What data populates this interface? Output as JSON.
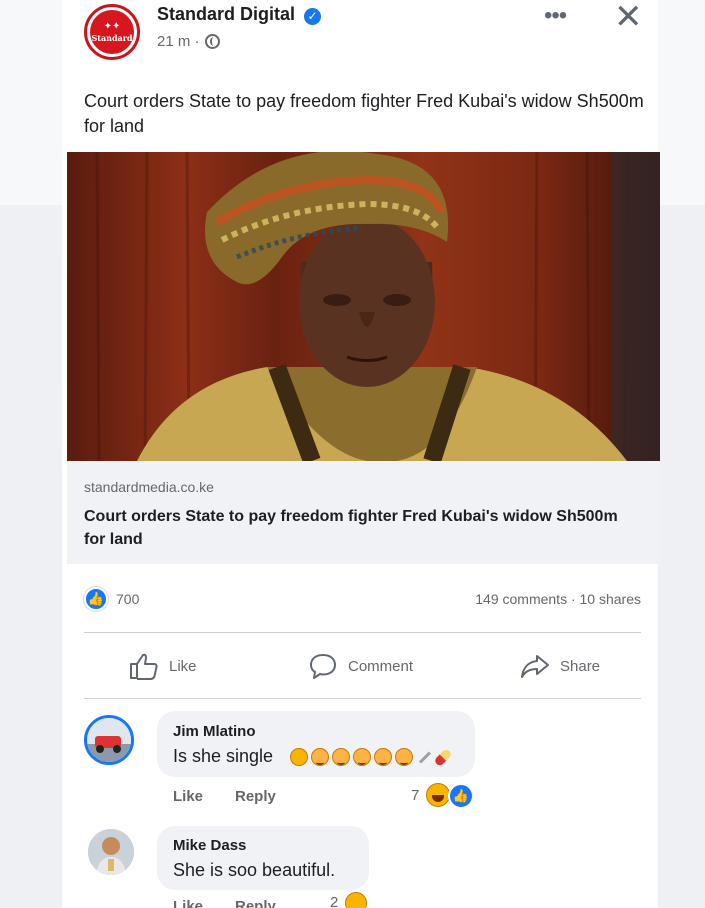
{
  "post": {
    "page_name": "Standard Digital",
    "time": "21 m ·",
    "text": "Court orders State to pay freedom fighter Fred Kubai's widow Sh500m for land",
    "avatar_logo_text": "Standard"
  },
  "link_preview": {
    "domain": "standardmedia.co.ke",
    "title": "Court orders State to pay freedom fighter Fred Kubai's widow Sh500m for land"
  },
  "stats": {
    "reactions": "700",
    "comments_shares": "149 comments · 10 shares"
  },
  "actions": {
    "like": "Like",
    "comment": "Comment",
    "share": "Share"
  },
  "comments": [
    {
      "author": "Jim Mlatino",
      "text": "Is she single",
      "like": "Like",
      "reply": "Reply",
      "reaction_count": "7"
    },
    {
      "author": "Mike Dass",
      "text": "She is soo beautiful.",
      "like": "Like",
      "reply": "Reply",
      "reaction_count": "2"
    }
  ],
  "colors": {
    "brand_red": "#d6171f",
    "facebook_blue": "#1877f2",
    "secondary_text": "#65676b"
  },
  "icons": [
    "verified-badge-icon",
    "globe-icon",
    "more-icon",
    "close-icon",
    "like-icon",
    "comment-icon",
    "share-icon",
    "haha-icon"
  ]
}
